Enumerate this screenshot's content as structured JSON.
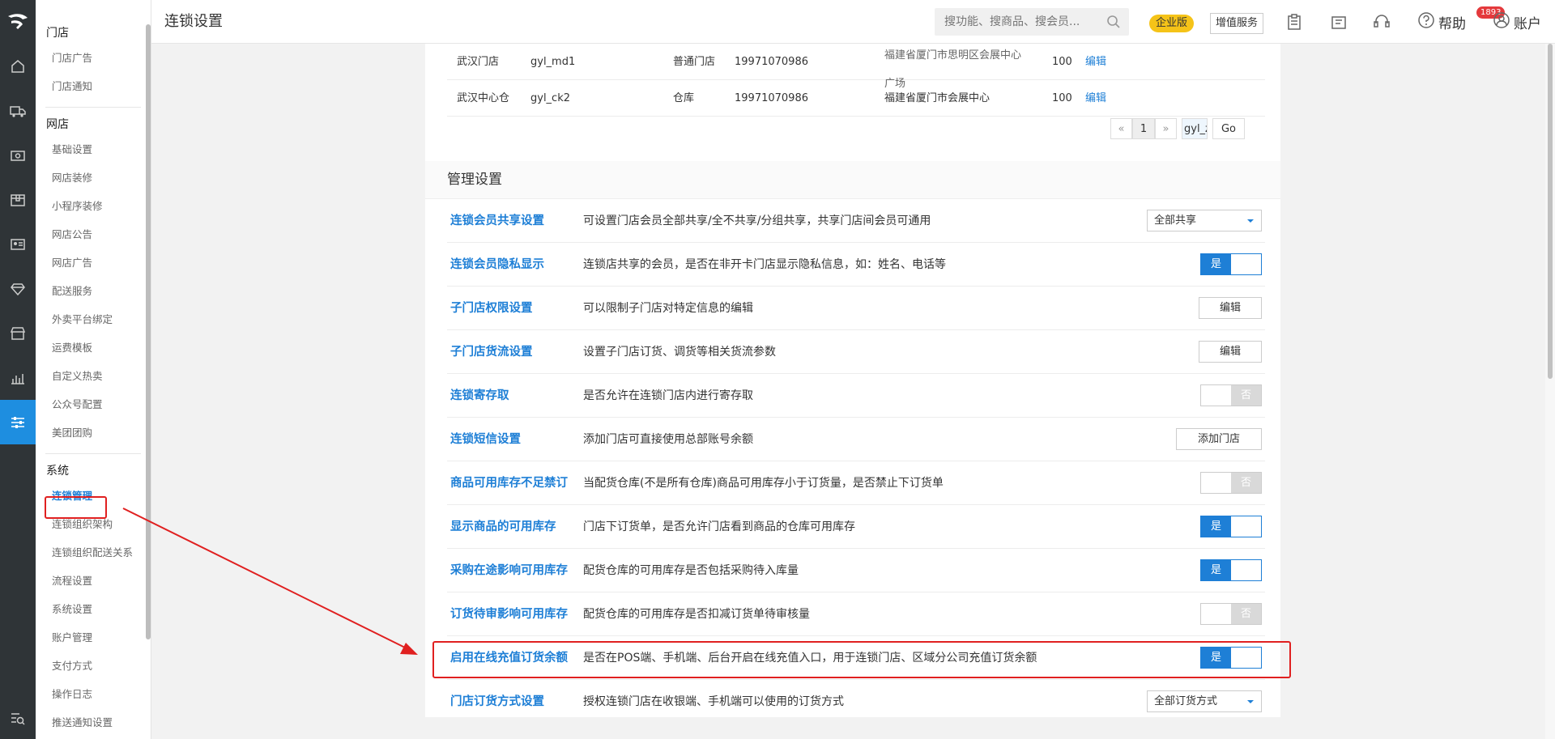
{
  "rail": {
    "icons": [
      "home-icon",
      "truck-icon",
      "cash-icon",
      "box-icon",
      "id-card-icon",
      "diamond-icon",
      "shop-icon",
      "chart-icon",
      "settings-sliders-icon"
    ],
    "active_index": 8,
    "bottom_icon": "search-list-icon",
    "logo_icon": "brand-logo-icon"
  },
  "sidebar": {
    "groups": [
      {
        "title": "门店",
        "items": [
          "门店广告",
          "门店通知"
        ]
      },
      {
        "title": "网店",
        "items": [
          "基础设置",
          "网店装修",
          "小程序装修",
          "网店公告",
          "网店广告",
          "配送服务",
          "外卖平台绑定",
          "运费模板",
          "自定义热卖",
          "公众号配置",
          "美团团购"
        ]
      },
      {
        "title": "系统",
        "items": [
          "连锁管理",
          "连锁组织架构",
          "连锁组织配送关系",
          "流程设置",
          "系统设置",
          "账户管理",
          "支付方式",
          "操作日志",
          "推送通知设置"
        ]
      }
    ],
    "active_item": "连锁管理"
  },
  "header": {
    "title": "连锁设置",
    "search_placeholder": "搜功能、搜商品、搜会员...",
    "enterprise_badge": "企业版",
    "value_added": "增值服务",
    "notify_count": "1893",
    "help_label": "帮助",
    "account_label": "账户"
  },
  "stores": {
    "rows": [
      {
        "name": "武汉门店",
        "code": "gyl_md1",
        "type": "普通门店",
        "phone": "19971070986",
        "address_line1": "福建省厦门市思明区会展中心",
        "address_line2": "广场",
        "sort": "100",
        "action": "编辑"
      },
      {
        "name": "武汉中心仓",
        "code": "gyl_ck2",
        "type": "仓库",
        "phone": "19971070986",
        "address_line1": "福建省厦门市会展中心",
        "address_line2": "",
        "sort": "100",
        "action": "编辑"
      }
    ],
    "pager": {
      "prev": "«",
      "page": "1",
      "next": "»",
      "jump_value": "gyl_z",
      "go": "Go"
    }
  },
  "management": {
    "title": "管理设置",
    "rows": [
      {
        "label": "连锁会员共享设置",
        "desc": "可设置门店会员全部共享/全不共享/分组共享，共享门店间会员可通用",
        "control": "select",
        "value": "全部共享"
      },
      {
        "label": "连锁会员隐私显示",
        "desc": "连锁店共享的会员，是否在非开卡门店显示隐私信息，如：姓名、电话等",
        "control": "toggle",
        "state": "on",
        "on_text": "是"
      },
      {
        "label": "子门店权限设置",
        "desc": "可以限制子门店对特定信息的编辑",
        "control": "button",
        "value": "编辑"
      },
      {
        "label": "子门店货流设置",
        "desc": "设置子门店订货、调货等相关货流参数",
        "control": "button",
        "value": "编辑"
      },
      {
        "label": "连锁寄存取",
        "desc": "是否允许在连锁门店内进行寄存取",
        "control": "toggle",
        "state": "off",
        "off_text": "否"
      },
      {
        "label": "连锁短信设置",
        "desc": "添加门店可直接使用总部账号余额",
        "control": "button",
        "value": "添加门店"
      },
      {
        "label": "商品可用库存不足禁订",
        "desc": "当配货仓库(不是所有仓库)商品可用库存小于订货量，是否禁止下订货单",
        "control": "toggle",
        "state": "off",
        "off_text": "否"
      },
      {
        "label": "显示商品的可用库存",
        "desc": "门店下订货单，是否允许门店看到商品的仓库可用库存",
        "control": "toggle",
        "state": "on",
        "on_text": "是"
      },
      {
        "label": "采购在途影响可用库存",
        "desc": "配货仓库的可用库存是否包括采购待入库量",
        "control": "toggle",
        "state": "on",
        "on_text": "是"
      },
      {
        "label": "订货待审影响可用库存",
        "desc": "配货仓库的可用库存是否扣减订货单待审核量",
        "control": "toggle",
        "state": "off",
        "off_text": "否"
      },
      {
        "label": "启用在线充值订货余额",
        "desc": "是否在POS端、手机端、后台开启在线充值入口，用于连锁门店、区域分公司充值订货余额",
        "control": "toggle",
        "state": "on",
        "on_text": "是",
        "highlighted": true
      },
      {
        "label": "门店订货方式设置",
        "desc": "授权连锁门店在收银端、手机端可以使用的订货方式",
        "control": "select",
        "value": "全部订货方式"
      }
    ]
  },
  "colors": {
    "accent": "#1e7fd6",
    "highlight": "#e02020",
    "rail_bg": "#2f3437",
    "enterprise": "#f5c318"
  }
}
